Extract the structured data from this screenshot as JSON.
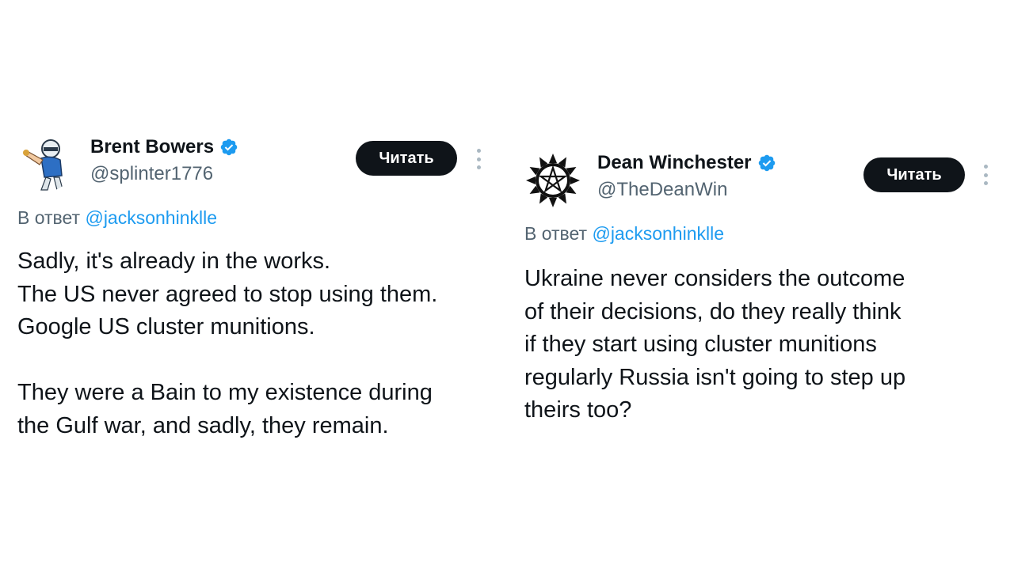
{
  "tweets": [
    {
      "display_name": "Brent Bowers",
      "handle": "@splinter1776",
      "verified": true,
      "follow_label": "Читать",
      "reply_prefix": "В ответ",
      "reply_to": "@jacksonhinklle",
      "text": "Sadly, it's already in the works.\nThe US never agreed to stop using them.\nGoogle US cluster munitions.\n\nThey were a Bain to my existence during\nthe Gulf war, and sadly, they remain.",
      "avatar_icon": "cartoon-figure-avatar"
    },
    {
      "display_name": "Dean Winchester",
      "handle": "@TheDeanWin",
      "verified": true,
      "follow_label": "Читать",
      "reply_prefix": "В ответ",
      "reply_to": "@jacksonhinklle",
      "text": "Ukraine never considers the outcome\nof their decisions, do they really think\nif they start using cluster munitions\nregularly Russia isn't going to step up\ntheirs too?",
      "avatar_icon": "pentagram-sun-avatar"
    }
  ],
  "colors": {
    "verified_badge": "#1d9bf0",
    "mention_link": "#1d9bf0",
    "follow_button_bg": "#0f1419",
    "secondary_text": "#536471"
  }
}
